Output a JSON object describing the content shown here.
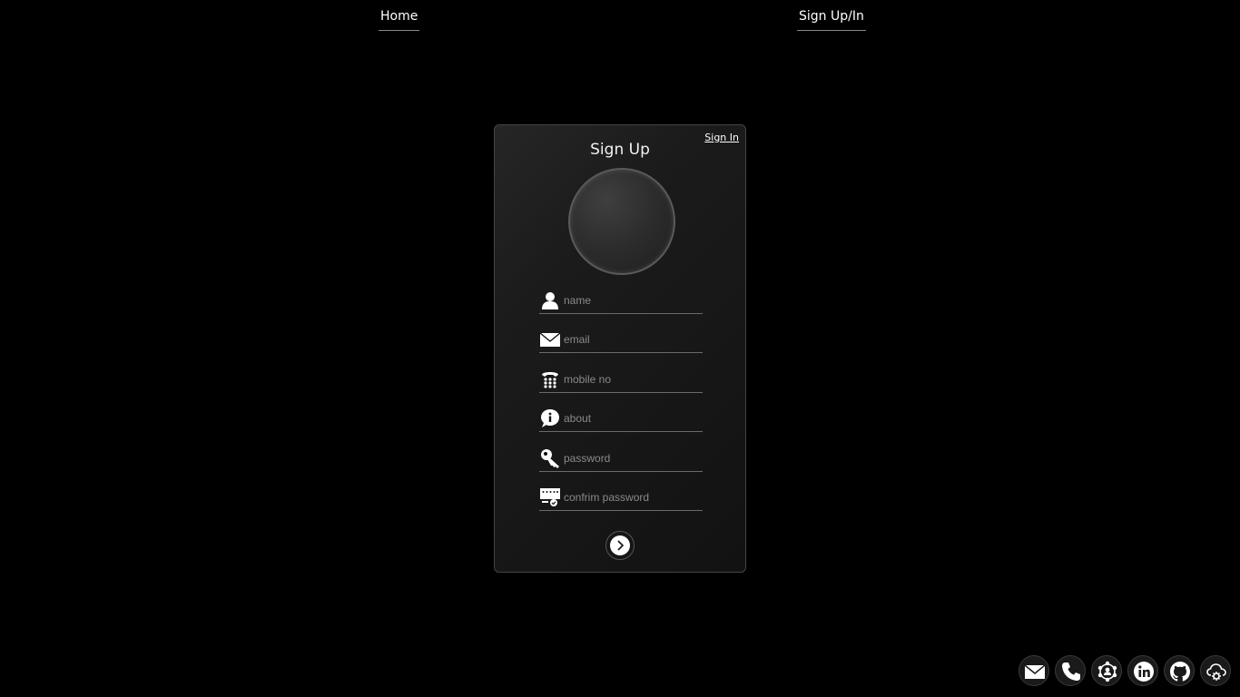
{
  "nav": {
    "home_label": "Home",
    "signup_label": "Sign Up/In"
  },
  "card": {
    "title": "Sign Up",
    "signin_link": "Sign In"
  },
  "form": {
    "fields": [
      {
        "name": "name",
        "placeholder": "name",
        "value": "",
        "icon": "user-icon"
      },
      {
        "name": "email",
        "placeholder": "email",
        "value": "",
        "icon": "envelope-icon"
      },
      {
        "name": "mobile",
        "placeholder": "mobile no",
        "value": "",
        "icon": "telephone-icon"
      },
      {
        "name": "about",
        "placeholder": "about",
        "value": "",
        "icon": "info-bubble-icon"
      },
      {
        "name": "password",
        "placeholder": "password",
        "value": "",
        "icon": "key-icon"
      },
      {
        "name": "confirm",
        "placeholder": "confrim password",
        "value": "",
        "icon": "password-check-icon"
      }
    ],
    "submit_icon": "chevron-right-icon"
  },
  "social": [
    {
      "icon": "mail-icon"
    },
    {
      "icon": "phone-icon"
    },
    {
      "icon": "network-icon"
    },
    {
      "icon": "linkedin-icon"
    },
    {
      "icon": "github-icon"
    },
    {
      "icon": "cloud-settings-icon"
    }
  ],
  "colors": {
    "background": "#000000",
    "card": "#1b1b1b",
    "text": "#ffffff",
    "placeholder": "#8a8a8a"
  }
}
